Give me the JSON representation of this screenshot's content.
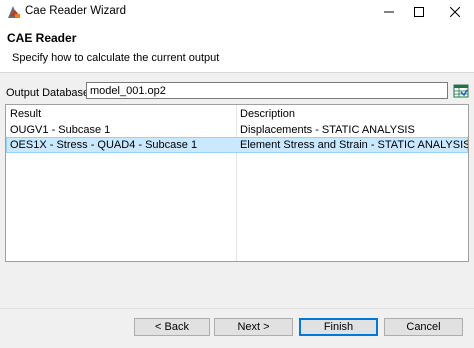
{
  "window": {
    "title": "Cae Reader Wizard"
  },
  "header": {
    "title": "CAE Reader",
    "description": "Specify how to calculate the current output"
  },
  "output_database": {
    "label": "Output Database:",
    "value": "model_001.op2"
  },
  "table": {
    "columns": [
      "Result",
      "Description"
    ],
    "rows": [
      {
        "result": "OUGV1 - Subcase 1",
        "description": "Displacements - STATIC ANALYSIS",
        "selected": false
      },
      {
        "result": "OES1X - Stress - QUAD4 - Subcase 1",
        "description": "Element Stress and Strain - STATIC ANALYSIS",
        "selected": true
      }
    ]
  },
  "buttons": {
    "back": "< Back",
    "next": "Next >",
    "finish": "Finish",
    "cancel": "Cancel"
  },
  "colors": {
    "selection": "#cce8ff",
    "accent": "#0078d7"
  }
}
